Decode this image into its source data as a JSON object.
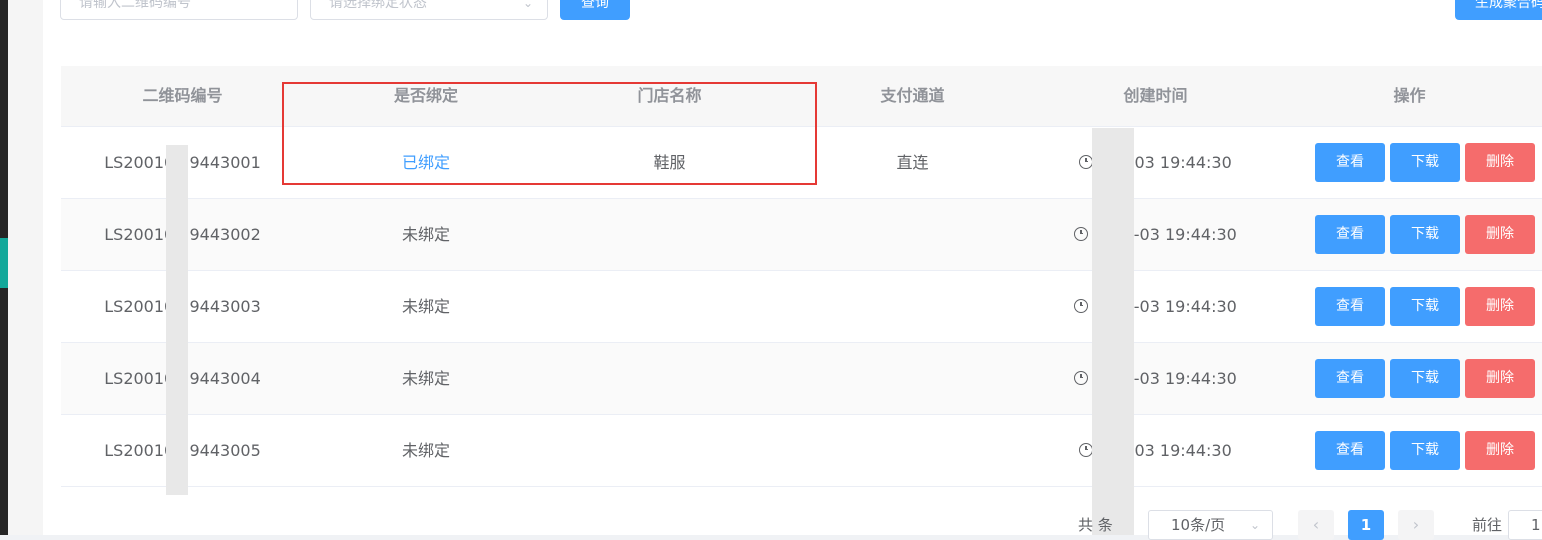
{
  "filters": {
    "code_placeholder": "请输入二维码编号",
    "bind_status_placeholder": "请选择绑定状态",
    "query_label": "查询",
    "generate_label": "生成聚合码"
  },
  "table": {
    "columns": [
      "二维码编号",
      "是否绑定",
      "门店名称",
      "支付通道",
      "创建时间",
      "操作"
    ],
    "rows": [
      {
        "code": "LS20010 19443001",
        "bind": "已绑定",
        "store": "鞋服",
        "channel": "直连",
        "time": "20 -03 19:44:30"
      },
      {
        "code": "LS20010 19443002",
        "bind": "未绑定",
        "store": "",
        "channel": "",
        "time": "20 1-03 19:44:30"
      },
      {
        "code": "LS20010 19443003",
        "bind": "未绑定",
        "store": "",
        "channel": "",
        "time": "20 1-03 19:44:30"
      },
      {
        "code": "LS20010 19443004",
        "bind": "未绑定",
        "store": "",
        "channel": "",
        "time": "20 1-03 19:44:30"
      },
      {
        "code": "LS20010 19443005",
        "bind": "未绑定",
        "store": "",
        "channel": "",
        "time": "2 1-03 19:44:30"
      }
    ],
    "actions": {
      "view": "查看",
      "download": "下载",
      "delete": "删除"
    }
  },
  "pagination": {
    "total_label": "共 条",
    "page_size": "10条/页",
    "current_page": "1",
    "jump_label": "前往",
    "jump_value": "1"
  },
  "colors": {
    "primary": "#409eff",
    "danger": "#f56c6c",
    "highlight": "#e53935"
  }
}
